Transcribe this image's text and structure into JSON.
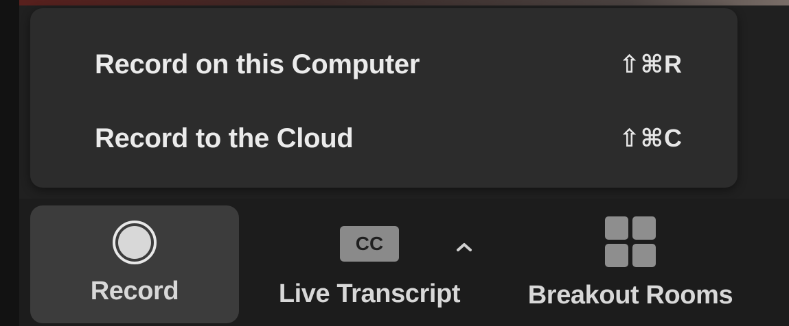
{
  "record_menu": {
    "items": [
      {
        "label": "Record on this Computer",
        "shortcut": "⇧⌘R"
      },
      {
        "label": "Record to the Cloud",
        "shortcut": "⇧⌘C"
      }
    ]
  },
  "toolbar": {
    "record": {
      "label": "Record",
      "icon": "record-icon"
    },
    "live_transcript": {
      "label": "Live Transcript",
      "icon": "cc-icon",
      "icon_text": "CC",
      "menu_icon": "chevron-up-icon"
    },
    "breakout_rooms": {
      "label": "Breakout Rooms",
      "icon": "grid-icon"
    }
  },
  "colors": {
    "menu_background": "#2c2c2c",
    "toolbar_background": "#1c1c1c",
    "active_button": "#3c3c3c",
    "text": "#ebebeb"
  }
}
